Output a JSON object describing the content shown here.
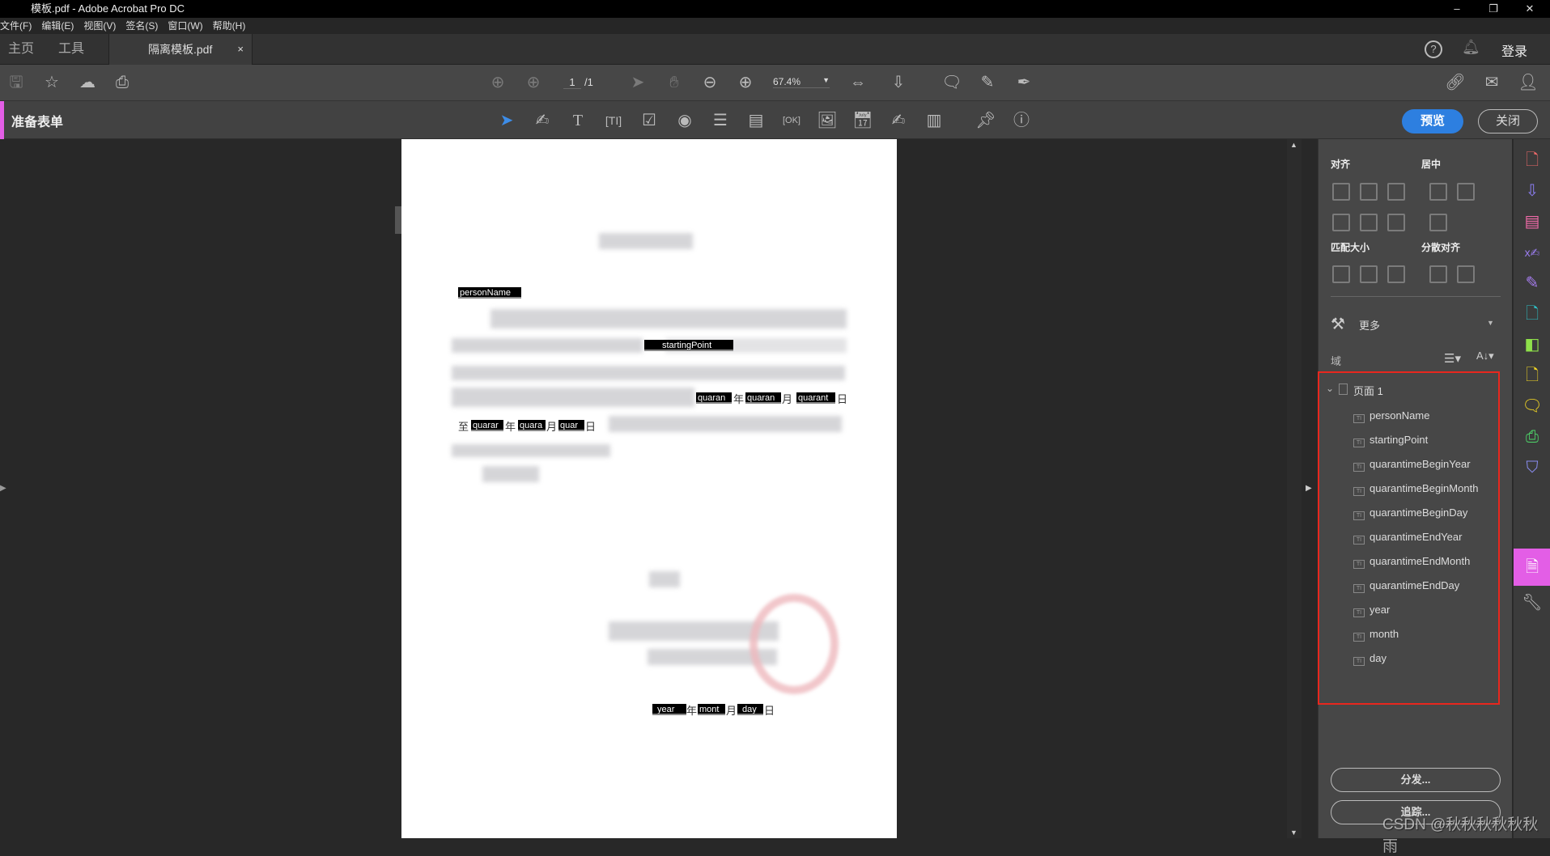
{
  "window": {
    "title": "模板.pdf - Adobe Acrobat Pro DC",
    "minimize": "–",
    "restore": "❐",
    "close": "✕"
  },
  "menu": [
    "文件(F)",
    "编辑(E)",
    "视图(V)",
    "签名(S)",
    "窗口(W)",
    "帮助(H)"
  ],
  "tabs": {
    "home": "主页",
    "tools": "工具",
    "document": "隔离模板.pdf",
    "close": "×"
  },
  "header_right": {
    "login": "登录"
  },
  "toolbar": {
    "page_current": "1",
    "page_total": "/1",
    "zoom": "67.4%"
  },
  "form_toolbar": {
    "title": "准备表单",
    "preview": "预览",
    "close": "关闭"
  },
  "document": {
    "fields": {
      "personName": "personName",
      "startingPoint": "startingPoint",
      "qby": "quaran",
      "qbm": "quaran",
      "qbd": "quarant",
      "qey": "quarar",
      "qem": "quara",
      "qed": "quar",
      "year": "year",
      "month": "mont",
      "day": "day"
    },
    "chars": {
      "to": "至",
      "year": "年",
      "month": "月",
      "day": "日"
    }
  },
  "panel": {
    "align": "对齐",
    "center": "居中",
    "match_size": "匹配大小",
    "distribute": "分散对齐",
    "more": "更多",
    "fields_label": "域",
    "tree_root": "页面 1",
    "fields": [
      "personName",
      "startingPoint",
      "quarantimeBeginYear",
      "quarantimeBeginMonth",
      "quarantimeBeginDay",
      "quarantimeEndYear",
      "quarantimeEndMonth",
      "quarantimeEndDay",
      "year",
      "month",
      "day"
    ],
    "distribute_btn": "分发...",
    "track_btn": "追踪..."
  },
  "watermark": "CSDN @秋秋秋秋秋秋雨",
  "colors": {
    "accent": "#2d7fe0",
    "form_tool": "#e35ee6",
    "highlight_box": "#e8271e"
  }
}
